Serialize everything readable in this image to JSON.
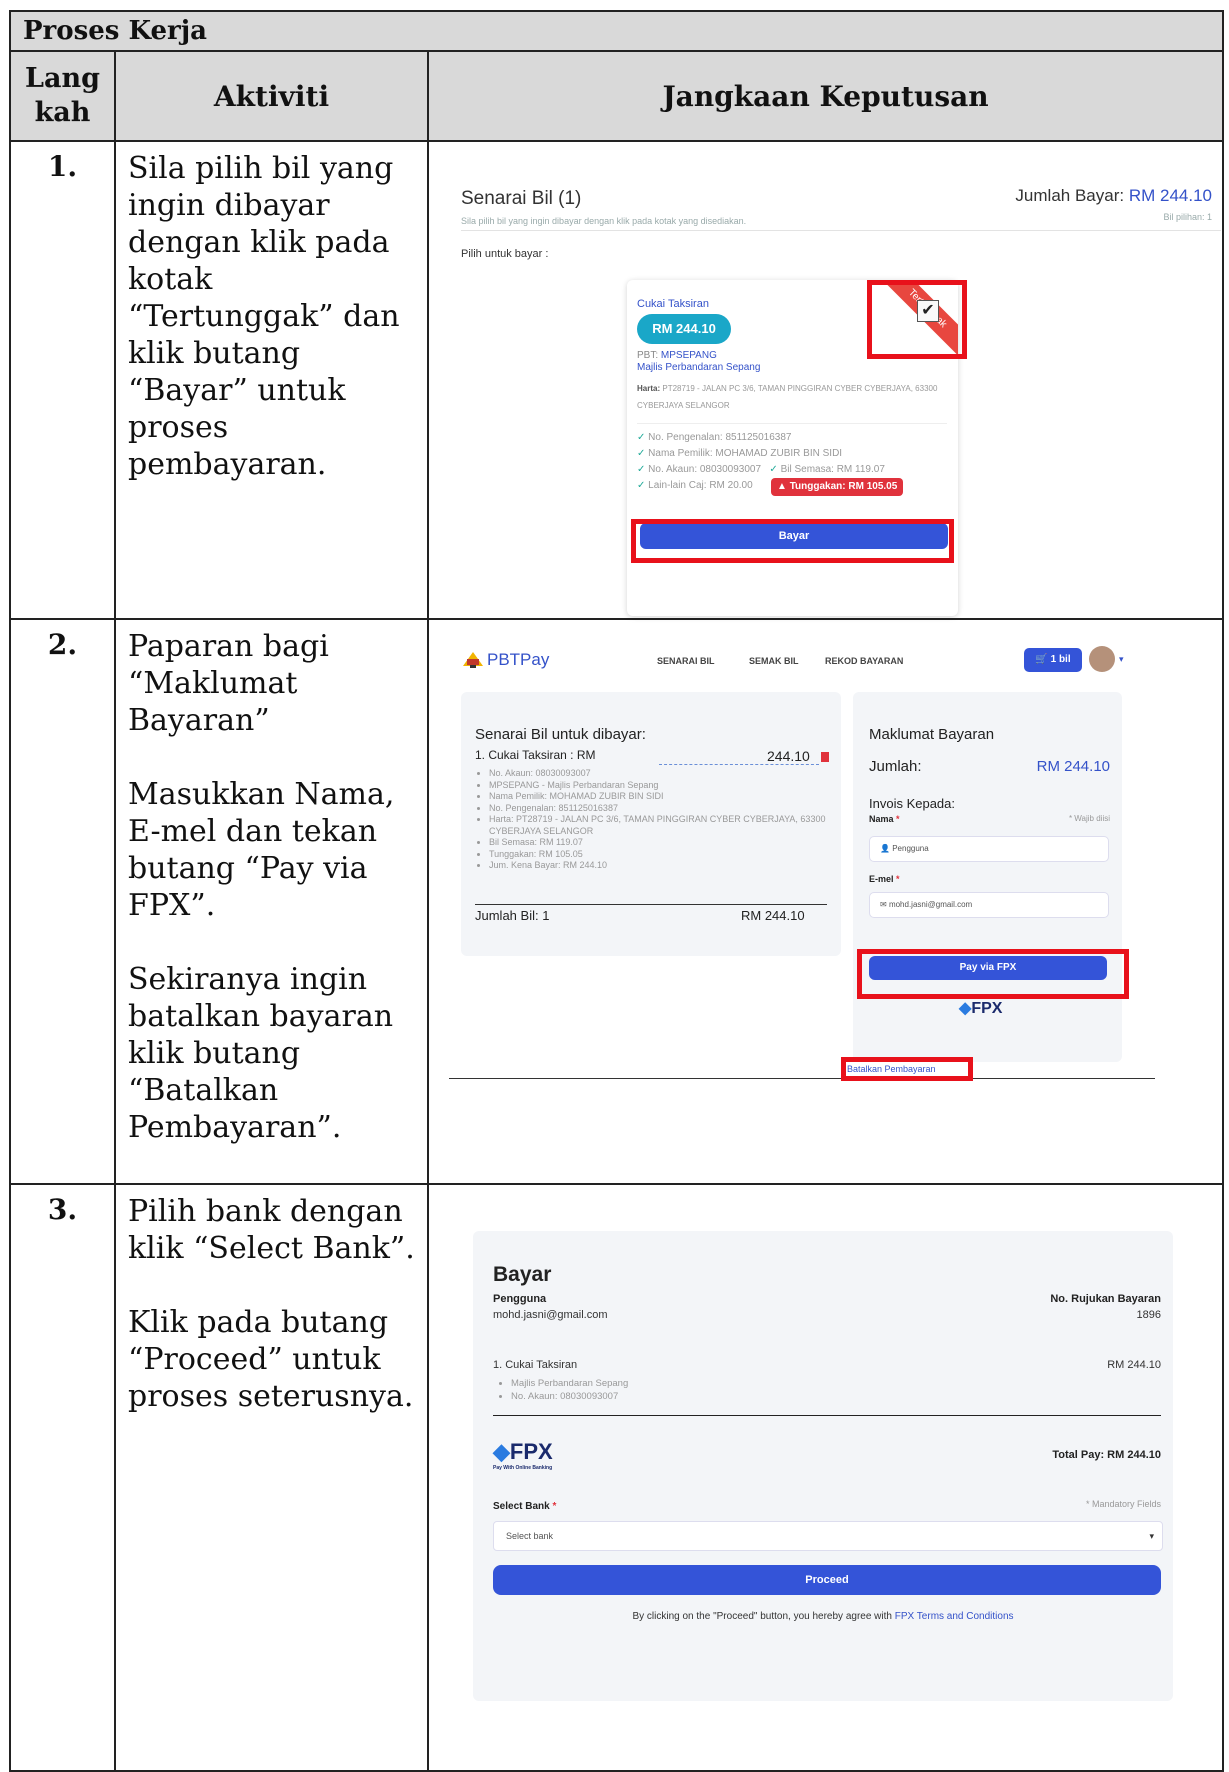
{
  "table": {
    "title": "Proses Kerja",
    "headers": {
      "step": "Lang\nkah",
      "activity": "Aktiviti",
      "expected": "Jangkaan Keputusan"
    }
  },
  "rows": [
    {
      "step": "1.",
      "activity": [
        "Sila pilih bil yang ingin dibayar dengan klik pada kotak “Tertunggak” dan klik butang “Bayar” untuk proses pembayaran."
      ]
    },
    {
      "step": "2.",
      "activity": [
        "Paparan bagi “Maklumat Bayaran”",
        "Masukkan Nama, E-mel dan tekan butang “Pay via FPX”.",
        "Sekiranya ingin batalkan bayaran klik butang “Batalkan Pembayaran”."
      ]
    },
    {
      "step": "3.",
      "activity": [
        "Pilih bank dengan klik “Select Bank”.",
        "Klik pada butang “Proceed” untuk proses seterusnya."
      ]
    }
  ],
  "shot1": {
    "heading": "Senarai Bil (1)",
    "total_label": "Jumlah Bayar:",
    "total_value": "RM 244.10",
    "hint": "Sila pilih bil yang ingin dibayar dengan klik pada kotak yang disediakan.",
    "selected": "Bil pilihan: 1",
    "choose_label": "Pilih untuk bayar :",
    "card": {
      "type": "Cukai Taksiran",
      "amount": "RM 244.10",
      "pbt_label": "PBT:",
      "pbt_code": "MPSEPANG",
      "council": "Majlis Perbandaran Sepang",
      "harta_label": "Harta:",
      "harta": "PT28719 - JALAN PC 3/6, TAMAN PINGGIRAN CYBER CYBERJAYA, 63300 CYBERJAYA SELANGOR",
      "ic": "No. Pengenalan: 851125016387",
      "owner": "Nama Pemilik: MOHAMAD ZUBIR BIN SIDI",
      "account": "No. Akaun: 08030093007",
      "current": "Bil Semasa: RM 119.07",
      "other": "Lain-lain Caj: RM 20.00",
      "arrears": "Tunggakan: RM 105.05",
      "ribbon": "Tertunggak",
      "pay_button": "Bayar"
    }
  },
  "shot2": {
    "brand": "PBTPay",
    "nav": [
      "SENARAI BIL",
      "SEMAK BIL",
      "REKOD BAYARAN"
    ],
    "cart": "1 bil",
    "list_title": "Senarai Bil untuk dibayar:",
    "item": "1. Cukai Taksiran : RM",
    "item_amount": "244.10",
    "details": [
      "No. Akaun: 08030093007",
      "MPSEPANG - Majlis Perbandaran Sepang",
      "Nama Pemilik: MOHAMAD ZUBIR BIN SIDI",
      "No. Pengenalan: 851125016387",
      "Harta: PT28719 - JALAN PC 3/6, TAMAN PINGGIRAN CYBER CYBERJAYA, 63300 CYBERJAYA SELANGOR",
      "Bil Semasa: RM 119.07",
      "Tunggakan: RM 105.05",
      "Jum. Kena Bayar: RM 244.10"
    ],
    "bill_count": "Jumlah Bil: 1",
    "bill_total": "RM 244.10",
    "info_title": "Maklumat Bayaran",
    "amount_label": "Jumlah:",
    "amount_value": "RM 244.10",
    "invoice_label": "Invois Kepada:",
    "name_label": "Nama",
    "required_note": "* Wajib diisi",
    "name_value": "Pengguna",
    "email_label": "E-mel",
    "email_value": "mohd.jasni@gmail.com",
    "pay_button": "Pay via FPX",
    "fpx": "FPX",
    "cancel_link": "Batalkan Pembayaran"
  },
  "shot3": {
    "title": "Bayar",
    "payer": "Pengguna",
    "email": "mohd.jasni@gmail.com",
    "ref_label": "No. Rujukan Bayaran",
    "ref_value": "1896",
    "item": "1. Cukai Taksiran",
    "item_amount": "RM 244.10",
    "details": [
      "Majlis Perbandaran Sepang",
      "No. Akaun: 08030093007"
    ],
    "fpx": "FPX",
    "fpx_tag": "Pay With Online Banking",
    "total": "Total Pay: RM 244.10",
    "bank_label": "Select Bank",
    "mandatory": "* Mandatory Fields",
    "bank_placeholder": "Select bank",
    "proceed": "Proceed",
    "terms_prefix": "By clicking on the \"Proceed\" button, you hereby agree with",
    "terms_link": "FPX Terms and Conditions"
  }
}
